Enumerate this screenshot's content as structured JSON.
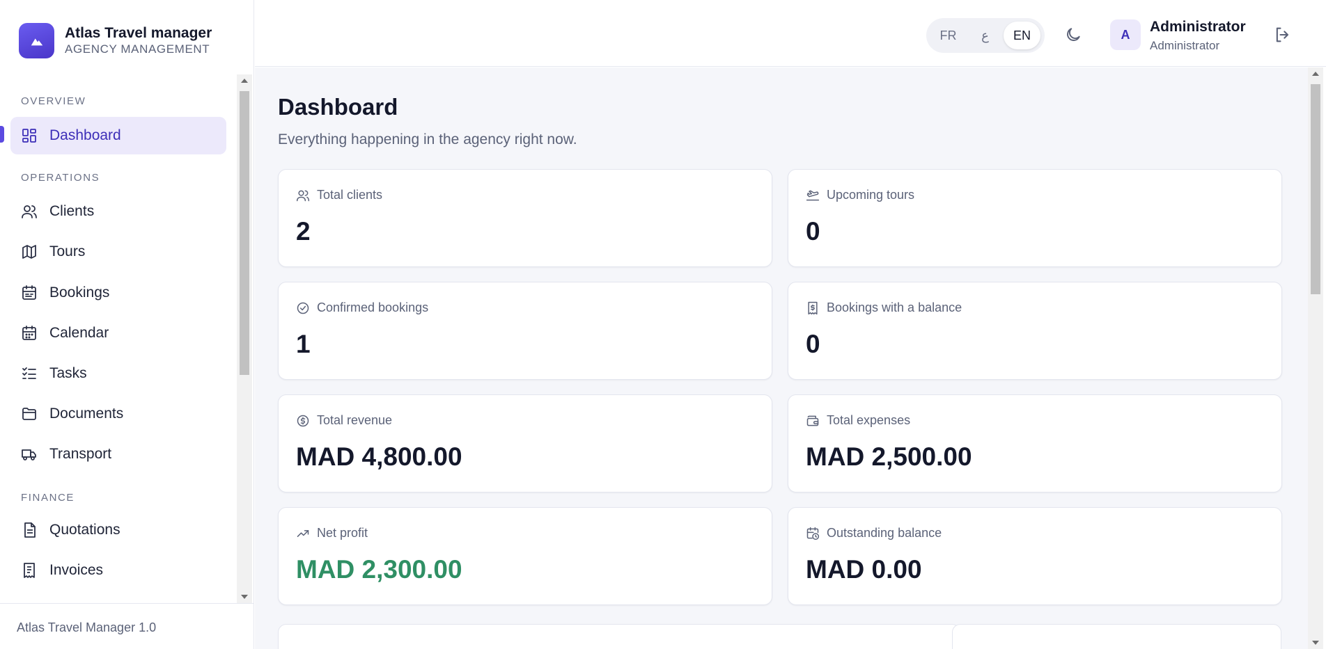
{
  "brand": {
    "title": "Atlas Travel manager",
    "subtitle": "AGENCY MANAGEMENT"
  },
  "sidebar": {
    "sections": [
      {
        "label": "OVERVIEW"
      },
      {
        "label": "OPERATIONS"
      },
      {
        "label": "FINANCE"
      }
    ],
    "items": [
      {
        "label": "Dashboard",
        "icon": "dashboard-grid-icon",
        "active": true
      },
      {
        "label": "Clients",
        "icon": "users-icon"
      },
      {
        "label": "Tours",
        "icon": "map-icon"
      },
      {
        "label": "Bookings",
        "icon": "calendar-list-icon"
      },
      {
        "label": "Calendar",
        "icon": "calendar-icon"
      },
      {
        "label": "Tasks",
        "icon": "checklist-icon"
      },
      {
        "label": "Documents",
        "icon": "folder-icon"
      },
      {
        "label": "Transport",
        "icon": "truck-icon"
      },
      {
        "label": "Quotations",
        "icon": "document-icon"
      },
      {
        "label": "Invoices",
        "icon": "receipt-icon"
      }
    ],
    "footer": "Atlas Travel Manager 1.0"
  },
  "header": {
    "languages": [
      {
        "code": "FR",
        "selected": false
      },
      {
        "code": "ع",
        "selected": false
      },
      {
        "code": "EN",
        "selected": true
      }
    ],
    "theme_icon": "moon-icon",
    "user": {
      "initial": "A",
      "name": "Administrator",
      "role": "Administrator"
    },
    "logout_icon": "logout-icon"
  },
  "page": {
    "title": "Dashboard",
    "subtitle": "Everything happening in the agency right now."
  },
  "stats": [
    {
      "label": "Total clients",
      "value": "2",
      "icon": "users-icon"
    },
    {
      "label": "Upcoming tours",
      "value": "0",
      "icon": "plane-departure-icon"
    },
    {
      "label": "Confirmed bookings",
      "value": "1",
      "icon": "check-circle-icon"
    },
    {
      "label": "Bookings with a balance",
      "value": "0",
      "icon": "receipt-dollar-icon"
    },
    {
      "label": "Total revenue",
      "value": "MAD 4,800.00",
      "icon": "dollar-circle-icon"
    },
    {
      "label": "Total expenses",
      "value": "MAD 2,500.00",
      "icon": "wallet-icon"
    },
    {
      "label": "Net profit",
      "value": "MAD 2,300.00",
      "icon": "trending-up-icon",
      "color": "#2f8f64"
    },
    {
      "label": "Outstanding balance",
      "value": "MAD 0.00",
      "icon": "calendar-clock-icon"
    }
  ],
  "colors": {
    "accent": "#5b4ae0",
    "active_bg": "#ece9fb",
    "profit": "#2f8f64"
  }
}
